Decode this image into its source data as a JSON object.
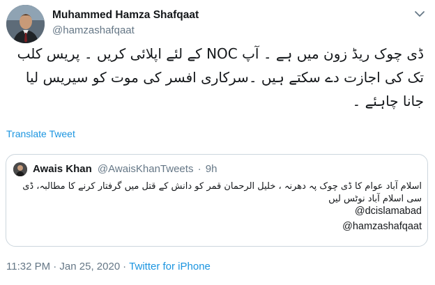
{
  "author": {
    "display_name": "Muhammed Hamza Shafqaat",
    "handle": "@hamzashafqaat",
    "avatar_icon": "profile-photo"
  },
  "tweet": {
    "text": "ڈی چوک ریڈ زون میں ہے ۔ آپ NOC کے لئے اپلائی کریں ۔ پریس کلب تک کی اجازت دے سکتے ہیں ۔سرکاری افسر کی موت کو سیریس لیا جانا چاہئے ۔",
    "translate_label": "Translate Tweet"
  },
  "quoted_tweet": {
    "display_name": "Awais Khan",
    "handle": "@AwaisKhanTweets",
    "separator": "·",
    "time_ago": "9h",
    "text": "اسلام آباد عوام کا ڈی چوک پہ دھرنہ ، خلیل الرحمان قمر کو دانش کے قتل میں گرفتار کرنے کا مطالبہ، ڈی سی اسلام آباد نوٹس لیں",
    "mention_1": "@dcislamabad",
    "mention_2": "@hamzashafqaat"
  },
  "meta": {
    "timestamp": "11:32 PM · Jan 25, 2020",
    "separator": "·",
    "source": "Twitter for iPhone"
  },
  "colors": {
    "link_blue": "#1b95e0",
    "secondary_gray": "#657786",
    "border_gray": "#ccd6dd",
    "text_dark": "#14171a"
  },
  "icons": {
    "more_menu": "chevron-down-icon"
  }
}
